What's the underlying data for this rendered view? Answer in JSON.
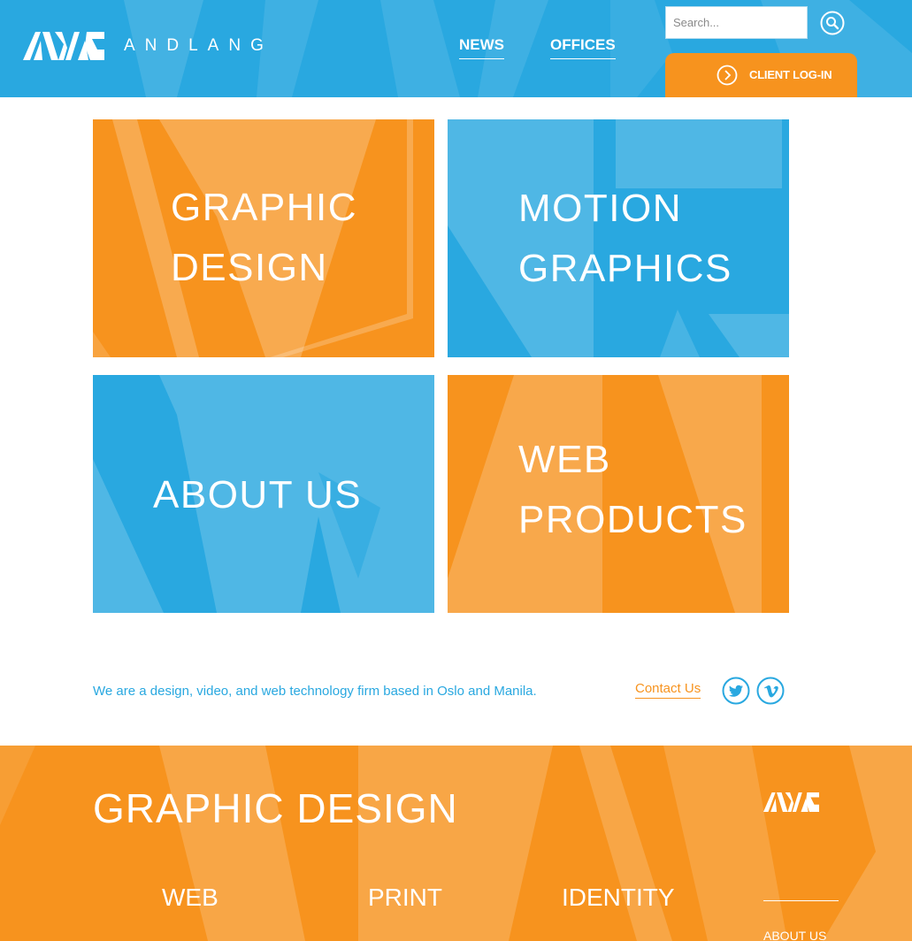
{
  "header": {
    "brand": "ANDLANG",
    "nav": [
      {
        "label": "NEWS"
      },
      {
        "label": "OFFICES"
      }
    ],
    "search": {
      "placeholder": "Search..."
    },
    "login_label": "CLIENT LOG-IN"
  },
  "tiles": [
    {
      "line1": "GRAPHIC",
      "line2": "DESIGN"
    },
    {
      "line1": "MOTION",
      "line2": "GRAPHICS"
    },
    {
      "line1": "ABOUT US"
    },
    {
      "line1": "WEB",
      "line2": "PRODUCTS"
    }
  ],
  "info": {
    "tagline": "We are a design, video, and web technology firm based in Oslo and Manila.",
    "contact": "Contact Us",
    "social": [
      "twitter-icon",
      "vimeo-icon"
    ]
  },
  "band": {
    "title": "GRAPHIC DESIGN",
    "items": [
      {
        "label": "WEB"
      },
      {
        "label": "PRINT"
      },
      {
        "label": "IDENTITY"
      }
    ],
    "side_link": "ABOUT US"
  },
  "colors": {
    "blue": "#29a8e0",
    "orange": "#f7931e"
  }
}
